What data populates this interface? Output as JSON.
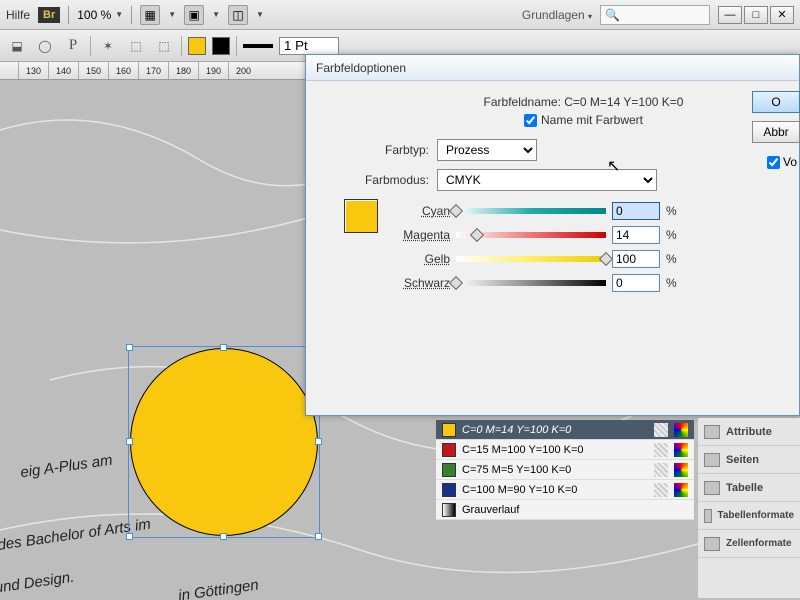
{
  "topbar": {
    "hilfe": "Hilfe",
    "br": "Br",
    "zoom": "100 %",
    "grundlagen": "Grundlagen"
  },
  "toolrow": {
    "stroke": "1 Pt"
  },
  "ruler": [
    "130",
    "140",
    "150",
    "160",
    "170",
    "180",
    "190",
    "200"
  ],
  "dialog": {
    "title": "Farbfeldoptionen",
    "name_label": "Farbfeldname:",
    "name_value": "C=0 M=14 Y=100 K=0",
    "name_with_value": "Name mit Farbwert",
    "farbtyp_label": "Farbtyp:",
    "farbtyp_value": "Prozess",
    "farbmodus_label": "Farbmodus:",
    "farbmodus_value": "CMYK",
    "ok": "O",
    "abbr": "Abbr",
    "vorschau": "Vo",
    "channels": {
      "c": {
        "label": "Cyan",
        "value": "0"
      },
      "m": {
        "label": "Magenta",
        "value": "14"
      },
      "y": {
        "label": "Gelb",
        "value": "100"
      },
      "k": {
        "label": "Schwarz",
        "value": "0"
      }
    },
    "pct": "%"
  },
  "swatches": [
    {
      "color": "#f9c80e",
      "label": "C=0 M=14 Y=100 K=0",
      "selected": true
    },
    {
      "color": "#c01818",
      "label": "C=15 M=100 Y=100 K=0",
      "selected": false
    },
    {
      "color": "#388030",
      "label": "C=75 M=5 Y=100 K=0",
      "selected": false
    },
    {
      "color": "#1a2f87",
      "label": "C=100 M=90 Y=10 K=0",
      "selected": false
    }
  ],
  "grauverlauf": "Grauverlauf",
  "panels": {
    "attribute": "Attribute",
    "seiten": "Seiten",
    "tabelle": "Tabelle",
    "tabellenformate": "Tabellenformate",
    "zellenformate": "Zellenformate"
  },
  "doc": {
    "t1": "eig A-Plus am",
    "t2": "Grades Bachelor of Arts im",
    "t3": "n und Design.",
    "t4": "in Göttingen"
  },
  "chart_data": {
    "type": "other",
    "note": "CMYK color swatch definition",
    "cyan": 0,
    "magenta": 14,
    "yellow": 100,
    "black": 0
  }
}
